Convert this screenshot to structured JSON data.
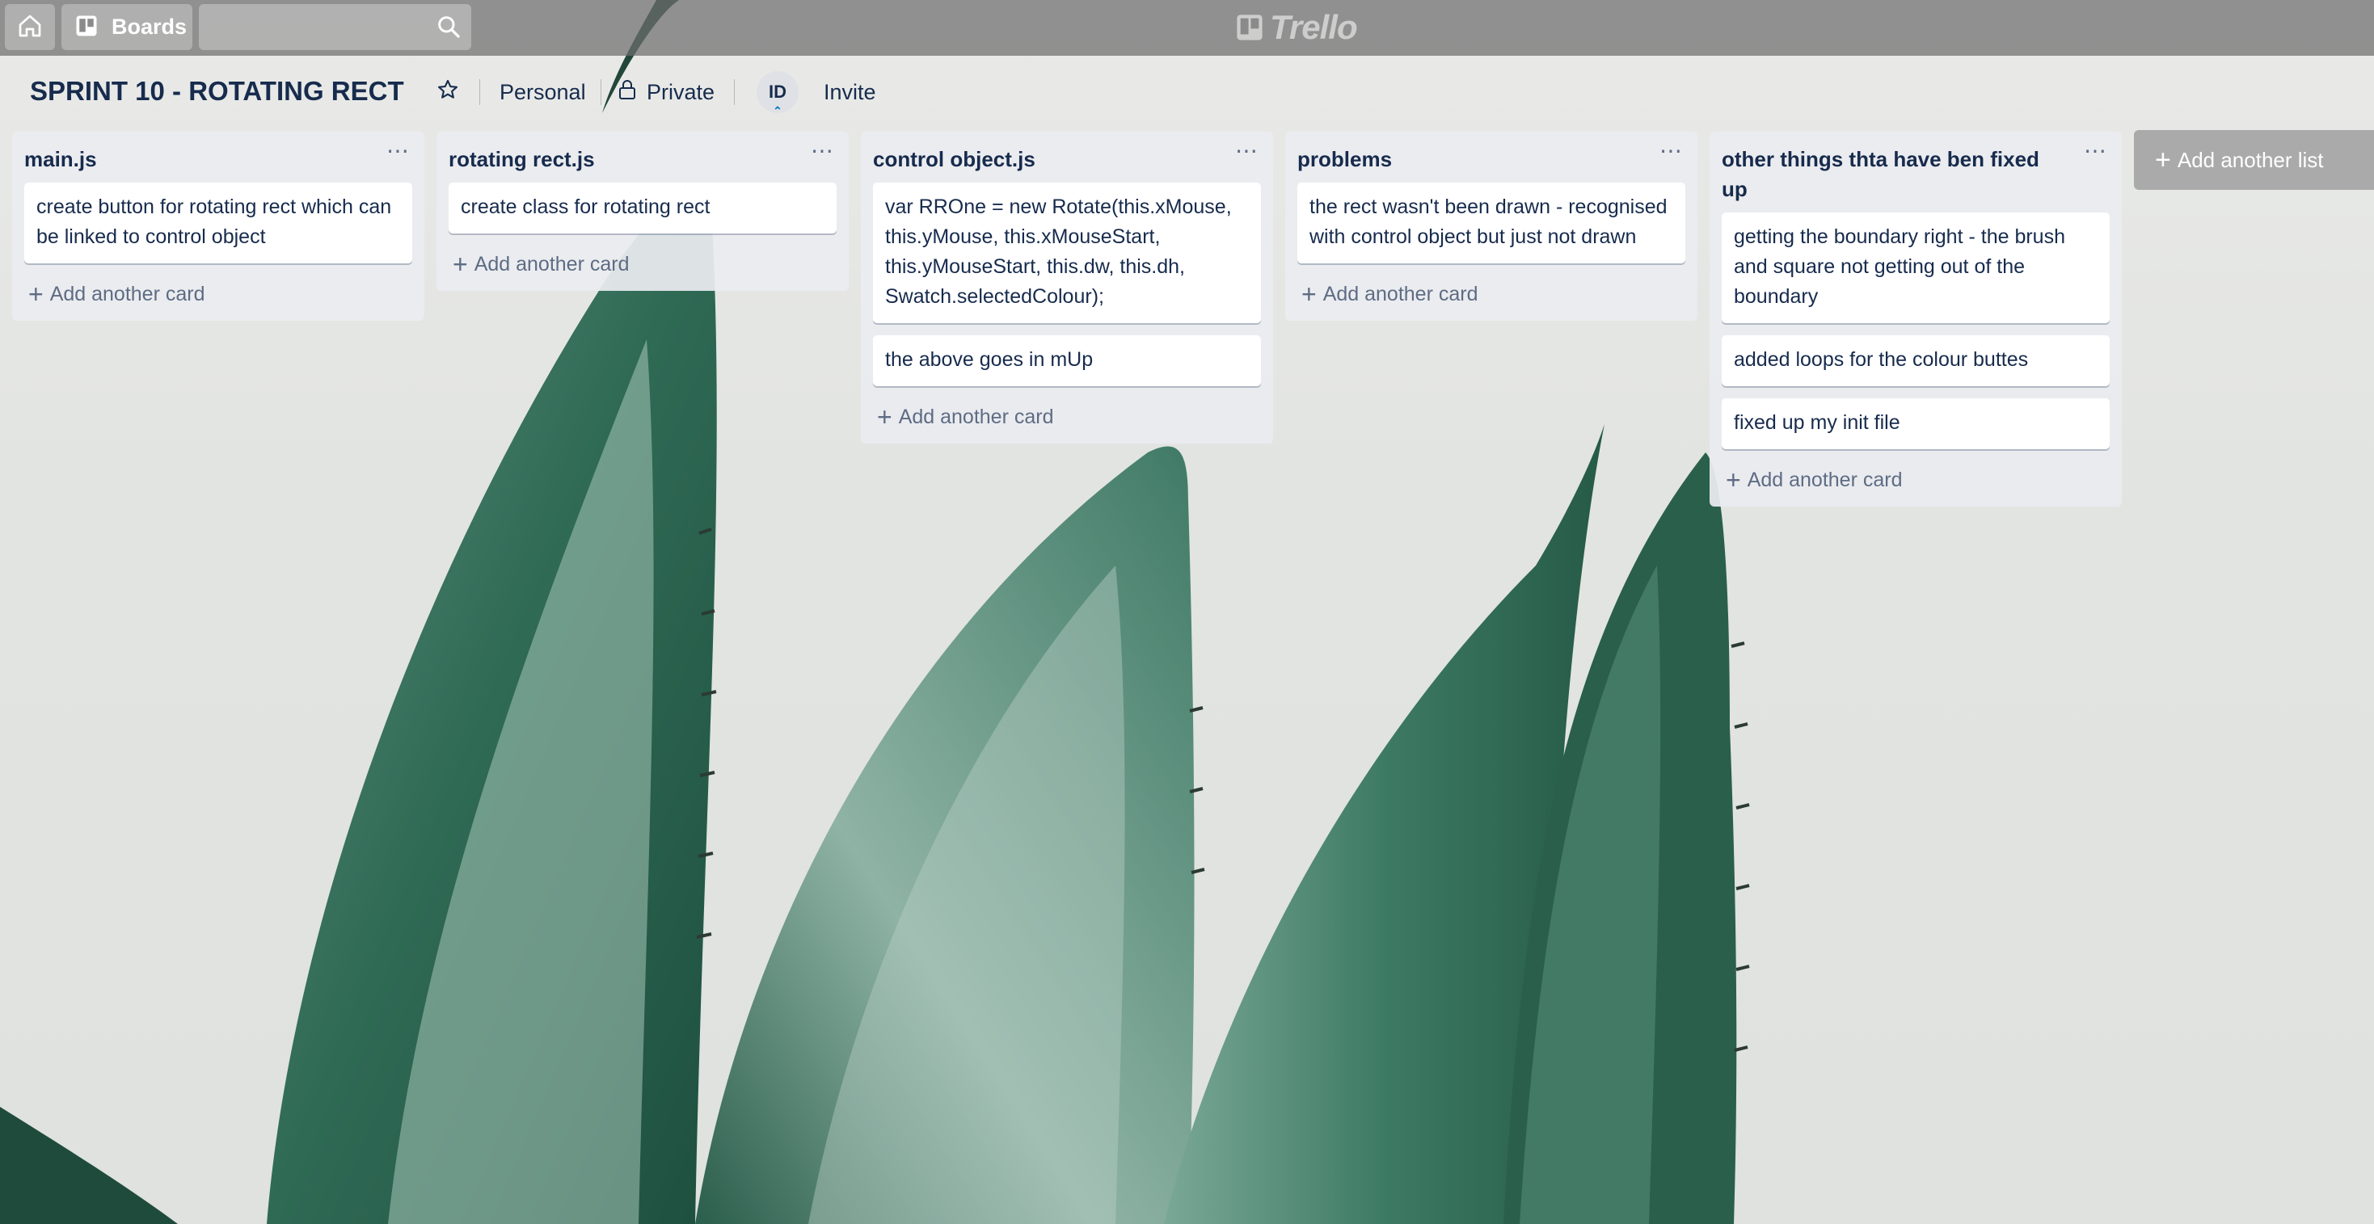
{
  "topbar": {
    "home_icon": "home-icon",
    "boards_label": "Boards",
    "boards_icon": "boards-icon",
    "search_value": "",
    "search_icon": "search-icon",
    "logo_text": "Trello"
  },
  "board": {
    "title": "SPRINT 10 - ROTATING RECT",
    "star_icon": "star-icon",
    "team": "Personal",
    "visibility": "Private",
    "visibility_icon": "lock-icon",
    "member_initials": "ID",
    "invite_label": "Invite"
  },
  "lists": [
    {
      "title": "main.js",
      "cards": [
        "create button for rotating rect which can be linked to control object"
      ],
      "add_card": "Add another card"
    },
    {
      "title": "rotating rect.js",
      "cards": [
        "create class for rotating rect"
      ],
      "add_card": "Add another card"
    },
    {
      "title": "control object.js",
      "cards": [
        "var RROne = new Rotate(this.xMouse, this.yMouse, this.xMouseStart, this.yMouseStart, this.dw, this.dh, Swatch.selectedColour);",
        "the above goes in mUp"
      ],
      "add_card": "Add another card"
    },
    {
      "title": "problems",
      "cards": [
        "the rect wasn't been drawn - recognised with control object but just not drawn"
      ],
      "add_card": "Add another card"
    },
    {
      "title": "other things thta have ben fixed up",
      "cards": [
        "getting the boundary right - the brush and square not getting out of the boundary",
        "added loops for the colour buttes",
        "fixed up my init file"
      ],
      "add_card": "Add another card"
    }
  ],
  "add_list_label": "Add another list",
  "colors": {
    "header_bg": "#6e6e6e",
    "list_bg": "#ebecf0",
    "text": "#172b4d",
    "muted": "#5e6c84",
    "plant": "#2f6a55"
  }
}
